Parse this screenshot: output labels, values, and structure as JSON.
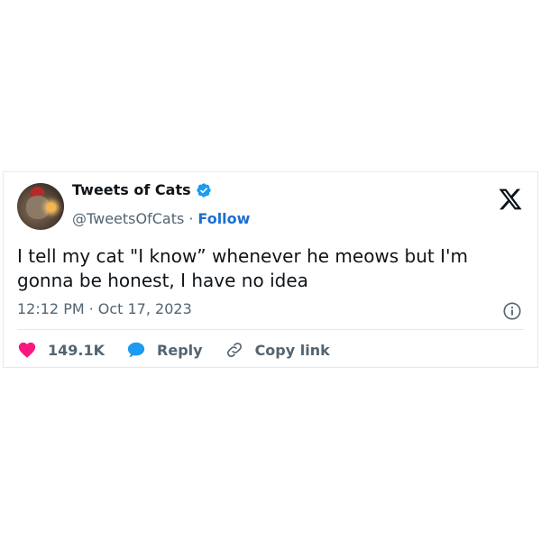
{
  "author": {
    "display_name": "Tweets of Cats",
    "handle": "@TweetsOfCats",
    "separator": "·",
    "follow_label": "Follow",
    "verified": true
  },
  "tweet": {
    "text": "I tell my cat \"I know” whenever he meows but I'm gonna be honest, I have no idea",
    "time": "12:12 PM",
    "date_separator": "·",
    "date": "Oct 17, 2023"
  },
  "actions": {
    "likes": "149.1K",
    "reply_label": "Reply",
    "copy_link_label": "Copy link"
  },
  "colors": {
    "like": "#f91880",
    "reply": "#1d9bf0",
    "follow": "#1d6fd1",
    "verified": "#1d9bf0"
  },
  "icons": [
    "verified-badge-icon",
    "x-logo-icon",
    "info-icon",
    "heart-icon",
    "reply-bubble-icon",
    "link-icon"
  ]
}
